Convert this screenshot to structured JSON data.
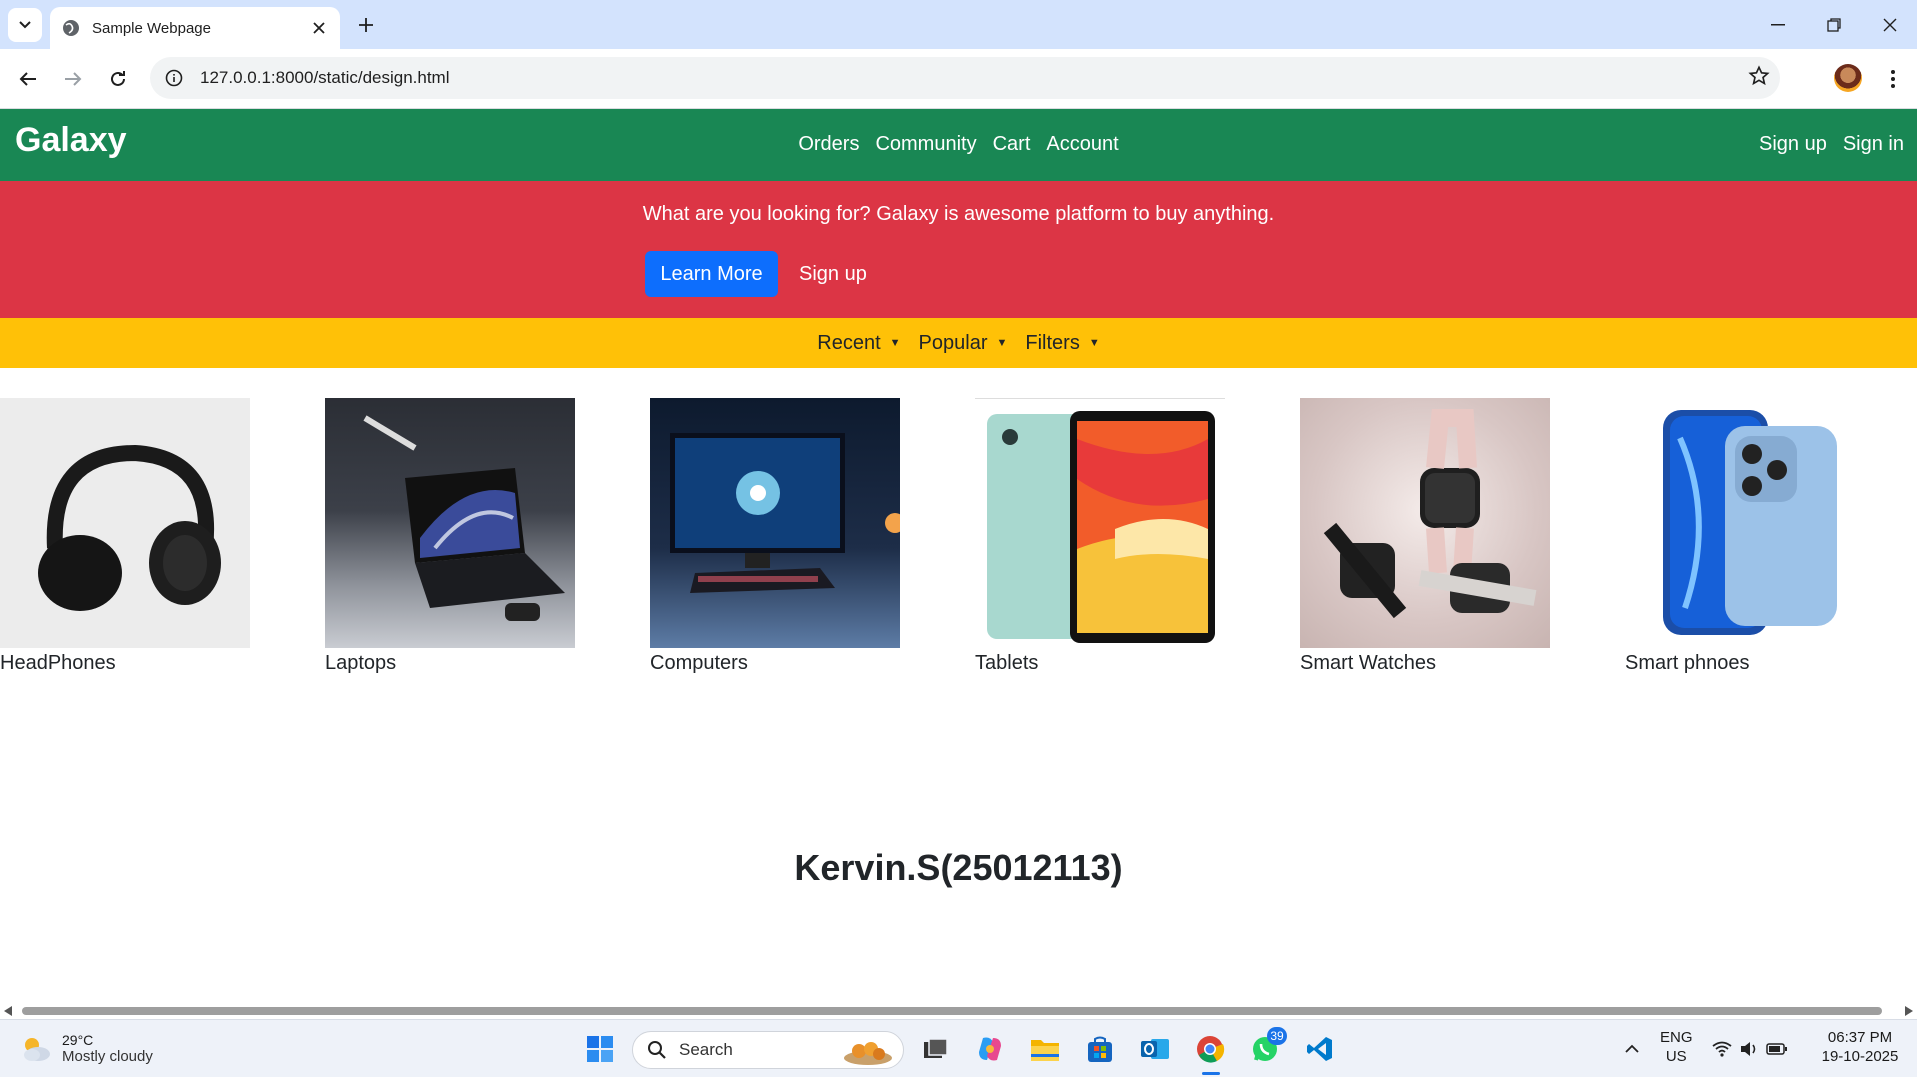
{
  "browser": {
    "tab_title": "Sample Webpage",
    "url": "127.0.0.1:8000/static/design.html"
  },
  "site": {
    "brand": "Galaxy",
    "nav": [
      "Orders",
      "Community",
      "Cart",
      "Account"
    ],
    "auth": [
      "Sign up",
      "Sign in"
    ],
    "hero_message": "What are you looking for? Galaxy is awesome platform to buy anything.",
    "learn_more": "Learn More",
    "hero_signup": "Sign up",
    "filters": [
      "Recent",
      "Popular",
      "Filters"
    ],
    "products": [
      "HeadPhones",
      "Laptops",
      "Computers",
      "Tablets",
      "Smart Watches",
      "Smart phnoes"
    ],
    "footer_name": "Kervin.S(25012113)",
    "colors": {
      "nav": "#198754",
      "hero": "#dc3545",
      "filterbar": "#ffc107",
      "button": "#0d6efd"
    }
  },
  "taskbar": {
    "temperature": "29°C",
    "weather": "Mostly cloudy",
    "search_placeholder": "Search",
    "whatsapp_badge": "39",
    "lang_top": "ENG",
    "lang_bottom": "US",
    "time": "06:37 PM",
    "date": "19-10-2025"
  }
}
